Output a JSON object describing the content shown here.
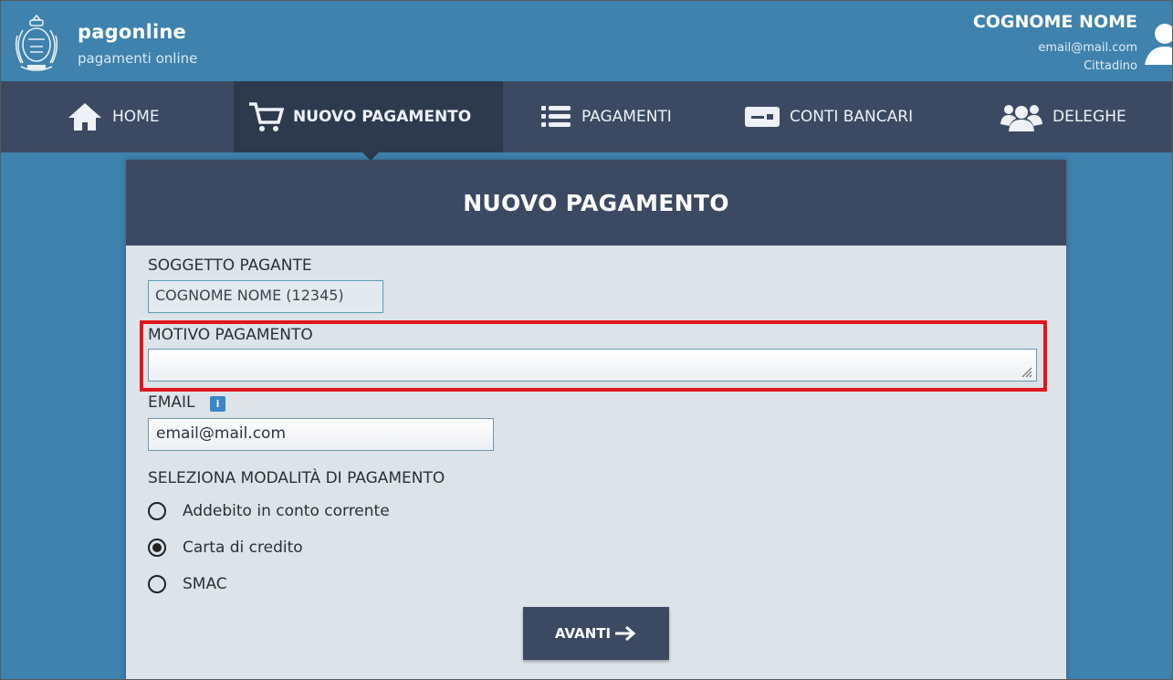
{
  "header": {
    "brand_title": "pagonline",
    "brand_subtitle": "pagamenti online",
    "user_name": "COGNOME NOME",
    "user_email": "email@mail.com",
    "user_role": "Cittadino"
  },
  "nav": {
    "items": [
      {
        "label": "HOME",
        "icon": "home-icon"
      },
      {
        "label": "NUOVO PAGAMENTO",
        "icon": "cart-icon",
        "active": true
      },
      {
        "label": "PAGAMENTI",
        "icon": "list-icon"
      },
      {
        "label": "CONTI BANCARI",
        "icon": "card-icon"
      },
      {
        "label": "DELEGHE",
        "icon": "users-icon"
      }
    ]
  },
  "panel": {
    "title": "NUOVO PAGAMENTO",
    "soggetto_label": "SOGGETTO PAGANTE",
    "soggetto_value": "COGNOME NOME (12345)",
    "motivo_label": "MOTIVO PAGAMENTO",
    "motivo_value": "",
    "email_label": "EMAIL",
    "email_value": "email@mail.com",
    "modalita_label": "SELEZIONA MODALITÀ DI PAGAMENTO",
    "options": [
      {
        "label": "Addebito in conto corrente",
        "checked": false
      },
      {
        "label": "Carta di credito",
        "checked": true
      },
      {
        "label": "SMAC",
        "checked": false
      }
    ],
    "next_button": "AVANTI"
  },
  "colors": {
    "background": "#3e82ad",
    "nav": "#3b4a62",
    "nav_active": "#2d3a4e",
    "panel": "#dce3e9",
    "highlight": "#e0161b"
  }
}
